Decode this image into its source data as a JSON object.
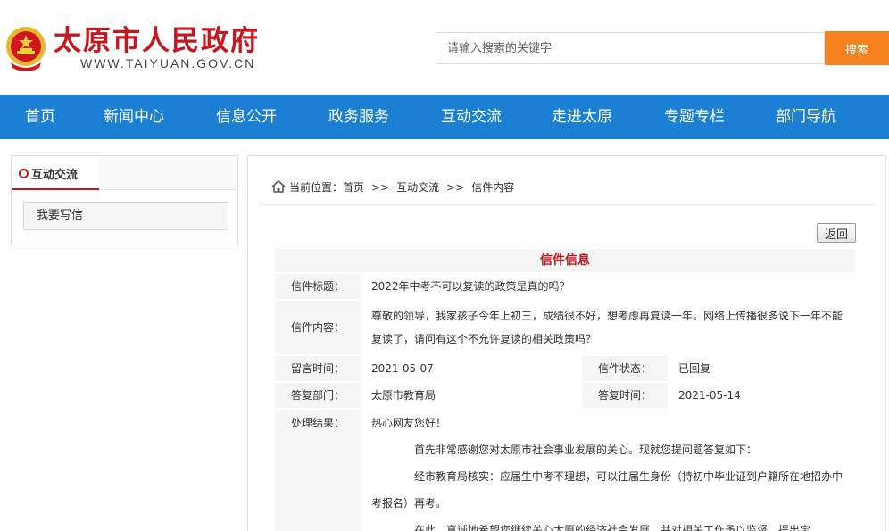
{
  "header": {
    "site_title": "太原市人民政府",
    "site_url": "WWW.TAIYUAN.GOV.CN",
    "search_placeholder": "请输入搜索的关键字",
    "search_button": "搜索"
  },
  "nav": {
    "items": [
      "首页",
      "新闻中心",
      "信息公开",
      "政务服务",
      "互动交流",
      "走进太原",
      "专题专栏",
      "部门导航"
    ]
  },
  "sidebar": {
    "title": "互动交流",
    "link": "我要写信"
  },
  "breadcrumb": {
    "prefix": "当前位置：",
    "items": [
      "首页",
      "互动交流",
      "信件内容"
    ],
    "separator": ">>"
  },
  "letter": {
    "back_button": "返回",
    "section_title": "信件信息",
    "labels": {
      "title": "信件标题：",
      "content": "信件内容：",
      "date": "留言时间：",
      "status": "信件状态：",
      "department": "答复部门：",
      "reply_time": "答复时间：",
      "result": "处理结果："
    },
    "title": "2022年中考不可以复读的政策是真的吗？",
    "content": "尊敬的领导，我家孩子今年上初三，成绩很不好，想考虑再复读一年。网络上传播很多说下一年不能复读了，请问有这个不允许复读的相关政策吗？",
    "date": "2021-05-07",
    "status": "已回复",
    "department": "太原市教育局",
    "reply_time": "2021-05-14",
    "result_lines": [
      "热心网友您好！",
      "首先非常感谢您对太原市社会事业发展的关心。现就您提问题答复如下：",
      "经市教育局核实：应届生中考不理想，可以往届生身份（持初中毕业证到户籍所在地招办中考报名）再考。",
      "在此，真诚地希望您继续关心太原的经济社会发展，并对相关工作予以监督，提出宝"
    ]
  },
  "colors": {
    "brand_red": "#c8161d",
    "nav_blue": "#1b7fd3",
    "search_orange": "#f5821f"
  }
}
